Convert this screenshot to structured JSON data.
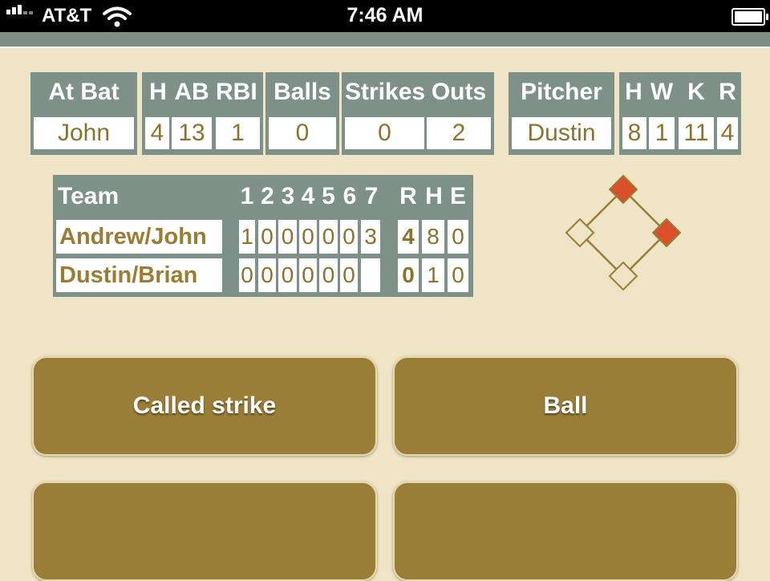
{
  "status_bar": {
    "carrier": "AT&T",
    "time": "7:46 AM"
  },
  "at_bat": {
    "header": "At Bat",
    "name": "John"
  },
  "batter_stats": {
    "headers": [
      "H",
      "AB",
      "RBI"
    ],
    "values": [
      "4",
      "13",
      "1"
    ]
  },
  "count": {
    "balls_label": "Balls",
    "balls": "0",
    "strikes_label": "Strikes",
    "strikes": "0",
    "outs_label": "Outs",
    "outs": "2"
  },
  "pitcher": {
    "header": "Pitcher",
    "name": "Dustin"
  },
  "pitcher_stats": {
    "headers": [
      "H",
      "W",
      "K",
      "R"
    ],
    "values": [
      "8",
      "1",
      "11",
      "4"
    ]
  },
  "scoreboard": {
    "team_header": "Team",
    "inning_headers": [
      "1",
      "2",
      "3",
      "4",
      "5",
      "6",
      "7"
    ],
    "totals_headers": [
      "R",
      "H",
      "E"
    ],
    "rows": [
      {
        "team": "Andrew/John",
        "innings": [
          "1",
          "0",
          "0",
          "0",
          "0",
          "0",
          "3"
        ],
        "r": "4",
        "h": "8",
        "e": "0"
      },
      {
        "team": "Dustin/Brian",
        "innings": [
          "0",
          "0",
          "0",
          "0",
          "0",
          "0",
          ""
        ],
        "r": "0",
        "h": "1",
        "e": "0"
      }
    ]
  },
  "bases": {
    "first": "occupied",
    "second": "occupied",
    "third": "empty",
    "occupied_color": "#d9502a",
    "line_color": "#9a7c34"
  },
  "actions": {
    "called_strike": "Called strike",
    "ball": "Ball"
  },
  "colors": {
    "background": "#efe4c5",
    "panel": "#7e9188",
    "text_gold": "#8a7331",
    "button": "#9a7e37"
  }
}
